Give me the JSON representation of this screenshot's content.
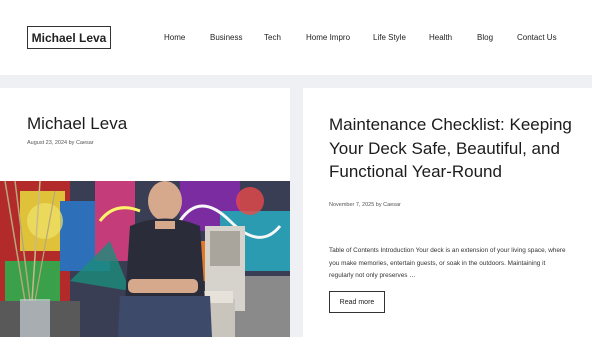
{
  "site": {
    "logo_text": "Michael Leva"
  },
  "nav": {
    "items": [
      {
        "label": "Home"
      },
      {
        "label": "Business"
      },
      {
        "label": "Tech"
      },
      {
        "label": "Home Impro"
      },
      {
        "label": "Life Style"
      },
      {
        "label": "Health"
      },
      {
        "label": "Blog"
      },
      {
        "label": "Contact Us"
      }
    ]
  },
  "posts": [
    {
      "title": "Michael Leva",
      "date": "August 23, 2024",
      "by": "by",
      "author": "Caesar"
    },
    {
      "title": "Maintenance Checklist: Keeping Your Deck Safe, Beautiful, and Functional Year-Round",
      "date": "November 7, 2025",
      "by": "by",
      "author": "Caesar",
      "excerpt": "Table of Contents Introduction Your deck is an extension of your living space, where you make memories, entertain guests, or soak in the outdoors. Maintaining it regularly not only preserves …",
      "read_more": "Read more"
    }
  ]
}
